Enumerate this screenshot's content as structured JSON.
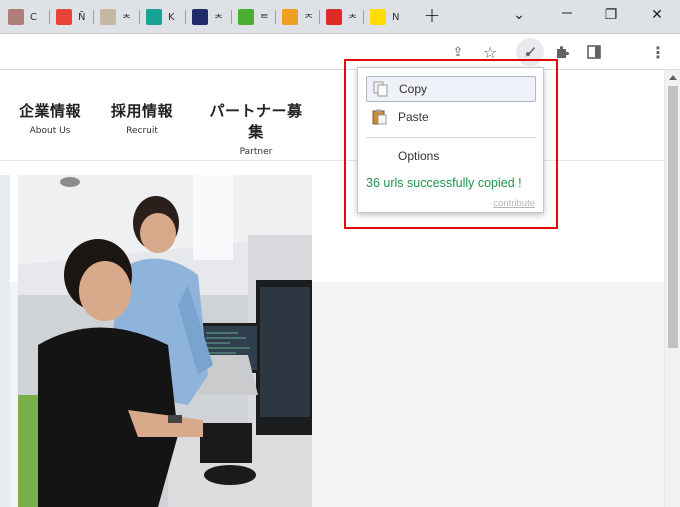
{
  "tabs": [
    {
      "label": "C",
      "icon": "bookmark-square-icon",
      "color": "#b07f7a"
    },
    {
      "label": "Ñ",
      "icon": "colorful-ball-icon",
      "color": "#e8423a"
    },
    {
      "label": "ᄎ",
      "icon": "grid-pattern-icon",
      "color": "#c6b7a3"
    },
    {
      "label": "K",
      "icon": "smiley-icon",
      "color": "#16a394"
    },
    {
      "label": "ᄎ",
      "icon": "w-letter-icon",
      "color": "#1f2a6b"
    },
    {
      "label": "ᄐ",
      "icon": "check-leaf-icon",
      "color": "#4cae2e"
    },
    {
      "label": "ᄌ",
      "icon": "bars-icon",
      "color": "#f0a020"
    },
    {
      "label": "ᄎ",
      "icon": "o-letter-icon",
      "color": "#e02a2a"
    },
    {
      "label": "N",
      "icon": "nikon-icon",
      "color": "#ffdd00"
    }
  ],
  "window": {
    "new_tab": "+",
    "chevron": "⌄",
    "restore": "❐",
    "close": "✕"
  },
  "toolbar": {
    "share": "⇪",
    "star": "☆",
    "ext_active": "✐",
    "puzzle": "✱",
    "sidepanel": "▣",
    "menu": "⋮"
  },
  "nav": [
    {
      "jp": "企業情報",
      "en": "About Us"
    },
    {
      "jp": "採用情報",
      "en": "Recruit"
    },
    {
      "jp": "パートナー募集",
      "en": "Partner"
    }
  ],
  "popup": {
    "copy": "Copy",
    "paste": "Paste",
    "options": "Options",
    "status": "36 urls successfully copied !",
    "contribute": "contribute"
  },
  "colors": {
    "highlight_border": "#e20b0b",
    "status_green": "#1f9350"
  }
}
